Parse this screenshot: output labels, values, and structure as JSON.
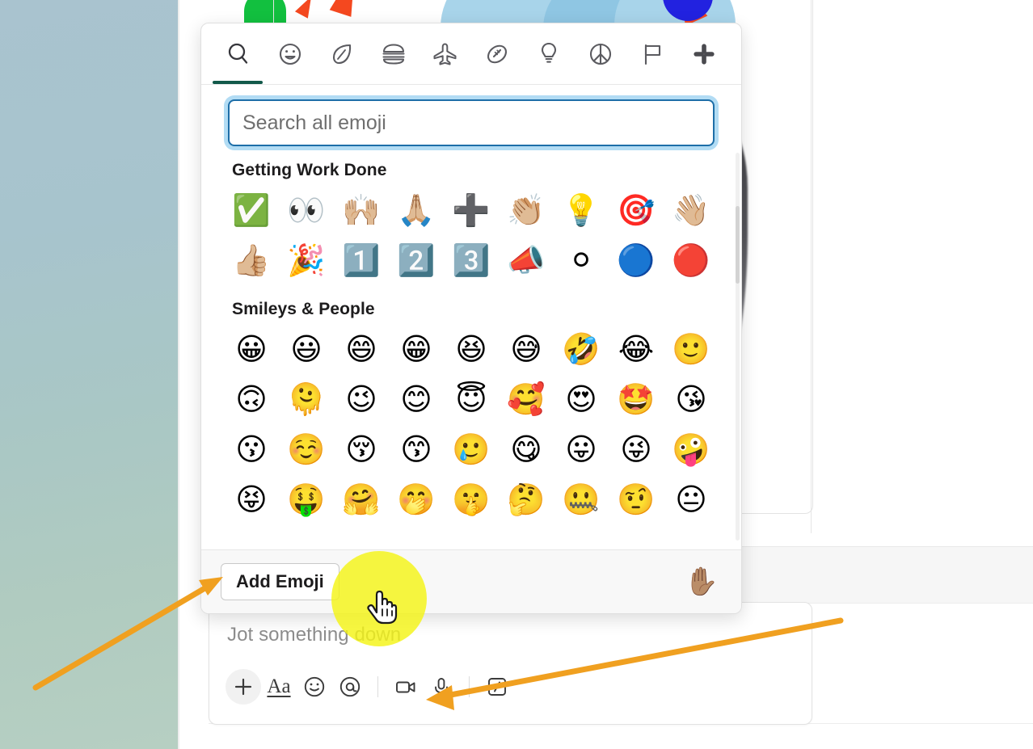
{
  "picker": {
    "tabs": [
      {
        "name": "search-tab",
        "icon": "magnifier-icon",
        "glyph": "search",
        "active": true
      },
      {
        "name": "smileys-tab",
        "icon": "smiley-face-icon",
        "glyph": "smiley",
        "active": false
      },
      {
        "name": "nature-tab",
        "icon": "leaf-icon",
        "glyph": "leaf",
        "active": false
      },
      {
        "name": "food-tab",
        "icon": "hamburger-icon",
        "glyph": "burger",
        "active": false
      },
      {
        "name": "travel-tab",
        "icon": "airplane-icon",
        "glyph": "plane",
        "active": false
      },
      {
        "name": "activities-tab",
        "icon": "football-icon",
        "glyph": "football",
        "active": false
      },
      {
        "name": "objects-tab",
        "icon": "lightbulb-icon",
        "glyph": "bulb",
        "active": false
      },
      {
        "name": "symbols-tab",
        "icon": "peace-sign-icon",
        "glyph": "peace",
        "active": false
      },
      {
        "name": "flags-tab",
        "icon": "flag-icon",
        "glyph": "flag",
        "active": false
      },
      {
        "name": "slack-tab",
        "icon": "slack-logo-icon",
        "glyph": "slack",
        "active": false
      }
    ],
    "search": {
      "placeholder": "Search all emoji",
      "value": ""
    },
    "sections": [
      {
        "title": "Getting Work Done",
        "emoji": [
          "✅",
          "👀",
          "🙌🏼",
          "🙏🏼",
          "➕",
          "👏🏼",
          "💡",
          "🎯",
          "👋🏼",
          "👍🏼",
          "🎉",
          "1️⃣",
          "2️⃣",
          "3️⃣",
          "📣",
          "⚪",
          "🔵",
          "🔴"
        ]
      },
      {
        "title": "Smileys & People",
        "emoji": [
          "😀",
          "😃",
          "😄",
          "😁",
          "😆",
          "😅",
          "🤣",
          "😂",
          "🙂",
          "🙃",
          "🫠",
          "😉",
          "😊",
          "😇",
          "🥰",
          "😍",
          "🤩",
          "😘",
          "😗",
          "☺️",
          "😚",
          "😙",
          "🥲",
          "😋",
          "😛",
          "😜",
          "🤪",
          "😝",
          "🤑",
          "🤗",
          "🤭",
          "🤫",
          "🤔",
          "🤐",
          "🤨",
          "😐"
        ]
      }
    ],
    "footer": {
      "add_emoji_label": "Add Emoji",
      "skin_tone_emoji": "✋🏽"
    },
    "colors": {
      "active_tab_indicator": "#12594a",
      "search_focus_border": "#1d6ea8",
      "search_focus_glow": "#54b2e6"
    }
  },
  "composer": {
    "placeholder": "Jot something down",
    "toolbar": [
      {
        "name": "add-attachment-button",
        "icon": "plus-icon",
        "label": "+"
      },
      {
        "name": "formatting-button",
        "icon": "text-format-icon",
        "label": "Aa"
      },
      {
        "name": "emoji-button",
        "icon": "smiley-icon",
        "label": ""
      },
      {
        "name": "mention-button",
        "icon": "at-mention-icon",
        "label": ""
      },
      {
        "name": "video-button",
        "icon": "video-camera-icon",
        "label": ""
      },
      {
        "name": "audio-button",
        "icon": "microphone-icon",
        "label": ""
      },
      {
        "name": "slash-command-button",
        "icon": "slash-command-icon",
        "label": ""
      }
    ]
  },
  "annotations": {
    "arrow_color": "#f0a020",
    "click_highlight_color": "#f4f416",
    "cursor": "pointing-hand"
  }
}
